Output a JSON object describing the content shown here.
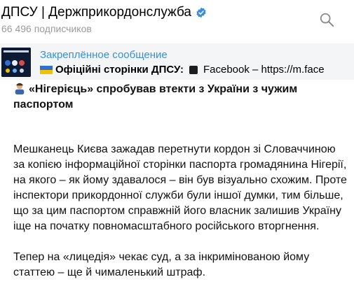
{
  "header": {
    "title": "ДПСУ | Держприкордонслужба",
    "subscribers": "66 496 подписчиков"
  },
  "pinned": {
    "label": "Закреплённое сообщение",
    "text_bold": "Офіційні сторінки ДПСУ:",
    "text_rest": "Facebook – https://m.face"
  },
  "message": {
    "headline": "«Нігерієць» спробував втекти з України з чужим паспортом",
    "paragraph1": "Мешканець Києва зажадав перетнути кордон зі Словаччиною за копією інформаційної сторінки паспорта громадянина Нігерії, на якого – як йому здавалося – він був візуально схожим. Проте інспектори прикордонної служби були іншої думки, тим більше, що за цим паспортом справжній його власник залишив Україну іще на початку повномасштабного російського вторгнення.",
    "paragraph2": "Тепер на «лицедія» чекає суд, а за інкримінованою йому статтею – ще й чималенький  штраф."
  },
  "colors": {
    "accent": "#3a8fd6",
    "verified": "#3a8fd6",
    "muted": "#9a9a9a",
    "pinned_bg": "#f4f5f7"
  },
  "icons": {
    "verified": "verified-badge-icon",
    "search": "search-icon",
    "flag": "ukraine-flag-icon",
    "square": "black-square-icon",
    "emoji": "person-emoji-icon"
  }
}
